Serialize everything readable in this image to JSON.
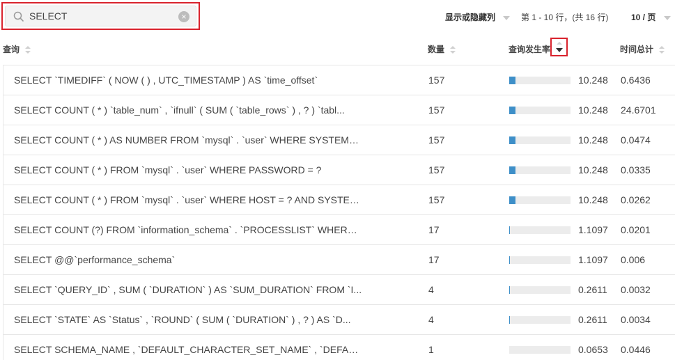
{
  "search": {
    "value": "SELECT",
    "placeholder": ""
  },
  "toolbar": {
    "column_toggle_label": "显示或隐藏列",
    "pager_text": "第 1 - 10 行，(共 16 行)",
    "page_size_label": "10 / 页"
  },
  "columns": {
    "query": "查询",
    "count": "数量",
    "rate": "查询发生率",
    "total": "时间总计"
  },
  "colors": {
    "bar_fill": "#3e8fc8",
    "bar_track": "#ececec",
    "highlight": "#d9232d"
  },
  "rows": [
    {
      "query": "SELECT `TIMEDIFF` ( NOW ( ) , UTC_TIMESTAMP ) AS `time_offset`",
      "count": "157",
      "rate": "10.248",
      "rate_fraction": 0.102,
      "total": "0.6436"
    },
    {
      "query": "SELECT COUNT ( * ) `table_num` , `ifnull` ( SUM ( `table_rows` ) , ? ) `tabl...",
      "count": "157",
      "rate": "10.248",
      "rate_fraction": 0.102,
      "total": "24.6701"
    },
    {
      "query": "SELECT COUNT ( * ) AS NUMBER FROM `mysql` . `user` WHERE SYSTEM_...",
      "count": "157",
      "rate": "10.248",
      "rate_fraction": 0.102,
      "total": "0.0474"
    },
    {
      "query": "SELECT COUNT ( * ) FROM `mysql` . `user` WHERE PASSWORD = ?",
      "count": "157",
      "rate": "10.248",
      "rate_fraction": 0.102,
      "total": "0.0335"
    },
    {
      "query": "SELECT COUNT ( * ) FROM `mysql` . `user` WHERE HOST = ? AND SYSTEM...",
      "count": "157",
      "rate": "10.248",
      "rate_fraction": 0.102,
      "total": "0.0262"
    },
    {
      "query": "SELECT COUNT (?) FROM `information_schema` . `PROCESSLIST` WHERE ...",
      "count": "17",
      "rate": "1.1097",
      "rate_fraction": 0.011,
      "total": "0.0201"
    },
    {
      "query": "SELECT @@`performance_schema`",
      "count": "17",
      "rate": "1.1097",
      "rate_fraction": 0.011,
      "total": "0.006"
    },
    {
      "query": "SELECT `QUERY_ID` , SUM ( `DURATION` ) AS `SUM_DURATION` FROM `I...",
      "count": "4",
      "rate": "0.2611",
      "rate_fraction": 0.0026,
      "total": "0.0032"
    },
    {
      "query": "SELECT `STATE` AS `Status` , `ROUND` ( SUM ( `DURATION` ) , ? ) AS `D...",
      "count": "4",
      "rate": "0.2611",
      "rate_fraction": 0.0026,
      "total": "0.0034"
    },
    {
      "query": "SELECT SCHEMA_NAME , `DEFAULT_CHARACTER_SET_NAME` , `DEFAULT_...",
      "count": "1",
      "rate": "0.0653",
      "rate_fraction": 0.0007,
      "total": "0.0446"
    }
  ]
}
